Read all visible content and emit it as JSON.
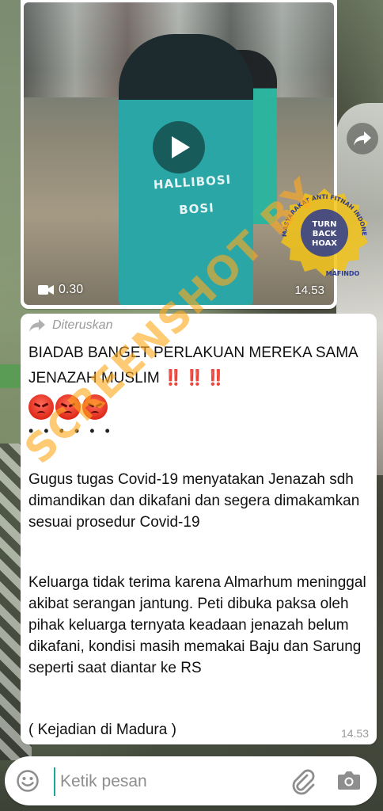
{
  "video": {
    "duration": "0.30",
    "time": "14.53",
    "shirt_text_line1": "HALLIBOSI",
    "shirt_text_line2": "BOSI"
  },
  "seal": {
    "ring_text": "MASYARAKAT ANTI FITNAH INDONESIA",
    "center_line1": "TURN",
    "center_line2": "BACK",
    "center_line3": "HOAX",
    "bottom_text": "MAFINDO"
  },
  "message": {
    "forwarded_label": "Diteruskan",
    "title": "BIADAB BANGET PERLAKUAN MEREKA SAMA JENAZAH MUSLIM",
    "title_marks": "‼️ ‼️ ‼️",
    "dots": "• • • • • •",
    "paragraph1": "Gugus tugas Covid-19 menyatakan Jenazah sdh dimandikan dan dikafani dan segera dimakamkan sesuai prosedur Covid-19",
    "paragraph2": "Keluarga tidak terima karena Almarhum meninggal akibat serangan jantung. Peti dibuka paksa oleh pihak keluarga ternyata keadaan jenazah belum dikafani, kondisi masih memakai Baju dan Sarung seperti saat diantar ke RS",
    "paragraph3": "( Kejadian di Madura )",
    "time": "14.53"
  },
  "watermark": "SCREENSHOT BY",
  "input": {
    "placeholder": "Ketik pesan"
  },
  "icons": {
    "play": "play-icon",
    "videocam": "videocam-icon",
    "share": "share-icon",
    "forwarded": "forward-arrow-icon",
    "emoji": "emoji-icon",
    "attach": "paperclip-icon",
    "camera": "camera-icon"
  },
  "colors": {
    "accent": "#1aa79a",
    "forward_gray": "#9a9a9a",
    "bang_red": "#e0261c",
    "watermark": "#ffaa1e",
    "seal_yellow": "#f2c318",
    "seal_blue": "#2d3b8e"
  }
}
